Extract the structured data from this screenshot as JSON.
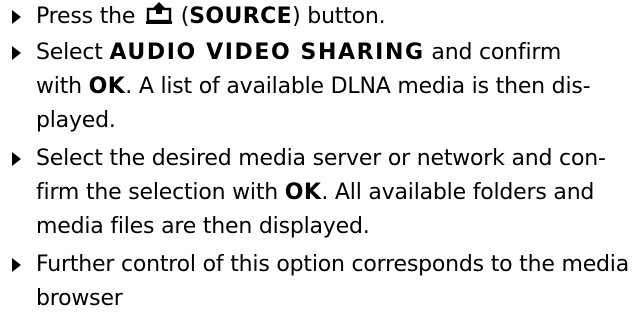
{
  "steps": [
    {
      "parts": [
        "Press the ",
        " (",
        "SOURCE",
        ") button."
      ]
    },
    {
      "parts": [
        "Select ",
        "AUDIO VIDEO SHARING",
        " and confirm",
        "with ",
        "OK",
        ". A list of available DLNA media is then dis-",
        "played."
      ]
    },
    {
      "parts": [
        "Select the desired media server or network and con-",
        "firm the selection with ",
        "OK",
        ". All available folders and",
        "media files are then displayed."
      ]
    },
    {
      "parts": [
        "Further control of this option corresponds to the media",
        "browser"
      ]
    }
  ],
  "icons": {
    "source": "source-input-icon",
    "bullet": "triangle-bullet-icon"
  },
  "colors": {
    "text": "#000000",
    "background": "#ffffff"
  }
}
